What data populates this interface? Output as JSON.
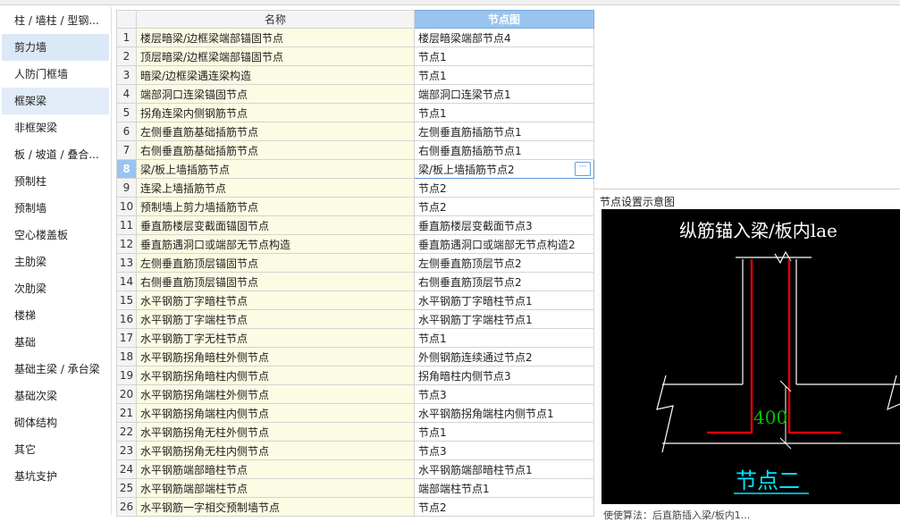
{
  "sidebar": {
    "items": [
      {
        "label": "柱 / 墙柱 / 型钢..."
      },
      {
        "label": "剪力墙"
      },
      {
        "label": "人防门框墙"
      },
      {
        "label": "框架梁"
      },
      {
        "label": "非框架梁"
      },
      {
        "label": "板 / 坡道 / 叠合..."
      },
      {
        "label": "预制柱"
      },
      {
        "label": "预制墙"
      },
      {
        "label": "空心楼盖板"
      },
      {
        "label": "主肋梁"
      },
      {
        "label": "次肋梁"
      },
      {
        "label": "楼梯"
      },
      {
        "label": "基础"
      },
      {
        "label": "基础主梁 / 承台梁"
      },
      {
        "label": "基础次梁"
      },
      {
        "label": "砌体结构"
      },
      {
        "label": "其它"
      },
      {
        "label": "基坑支护"
      }
    ]
  },
  "table": {
    "headers": {
      "index": "",
      "name": "名称",
      "node": "节点图"
    },
    "rows": [
      {
        "idx": "1",
        "name": "楼层暗梁/边框梁端部锚固节点",
        "node": "楼层暗梁端部节点4"
      },
      {
        "idx": "2",
        "name": "顶层暗梁/边框梁端部锚固节点",
        "node": "节点1"
      },
      {
        "idx": "3",
        "name": "暗梁/边框梁遇连梁构造",
        "node": "节点1"
      },
      {
        "idx": "4",
        "name": "端部洞口连梁锚固节点",
        "node": "端部洞口连梁节点1"
      },
      {
        "idx": "5",
        "name": "拐角连梁内侧钢筋节点",
        "node": "节点1"
      },
      {
        "idx": "6",
        "name": "左侧垂直筋基础插筋节点",
        "node": "左侧垂直筋插筋节点1"
      },
      {
        "idx": "7",
        "name": "右侧垂直筋基础插筋节点",
        "node": "右侧垂直筋插筋节点1"
      },
      {
        "idx": "8",
        "name": "梁/板上墙插筋节点",
        "node": "梁/板上墙插筋节点2"
      },
      {
        "idx": "9",
        "name": "连梁上墙插筋节点",
        "node": "节点2"
      },
      {
        "idx": "10",
        "name": "预制墙上剪力墙插筋节点",
        "node": "节点2"
      },
      {
        "idx": "11",
        "name": "垂直筋楼层变截面锚固节点",
        "node": "垂直筋楼层变截面节点3"
      },
      {
        "idx": "12",
        "name": "垂直筋遇洞口或端部无节点构造",
        "node": "垂直筋遇洞口或端部无节点构造2"
      },
      {
        "idx": "13",
        "name": "左侧垂直筋顶层锚固节点",
        "node": "左侧垂直筋顶层节点2"
      },
      {
        "idx": "14",
        "name": "右侧垂直筋顶层锚固节点",
        "node": "右侧垂直筋顶层节点2"
      },
      {
        "idx": "15",
        "name": "水平钢筋丁字暗柱节点",
        "node": "水平钢筋丁字暗柱节点1"
      },
      {
        "idx": "16",
        "name": "水平钢筋丁字端柱节点",
        "node": "水平钢筋丁字端柱节点1"
      },
      {
        "idx": "17",
        "name": "水平钢筋丁字无柱节点",
        "node": "节点1"
      },
      {
        "idx": "18",
        "name": "水平钢筋拐角暗柱外侧节点",
        "node": "外侧钢筋连续通过节点2"
      },
      {
        "idx": "19",
        "name": "水平钢筋拐角暗柱内侧节点",
        "node": "拐角暗柱内侧节点3"
      },
      {
        "idx": "20",
        "name": "水平钢筋拐角端柱外侧节点",
        "node": "节点3"
      },
      {
        "idx": "21",
        "name": "水平钢筋拐角端柱内侧节点",
        "node": "水平钢筋拐角端柱内侧节点1"
      },
      {
        "idx": "22",
        "name": "水平钢筋拐角无柱外侧节点",
        "node": "节点1"
      },
      {
        "idx": "23",
        "name": "水平钢筋拐角无柱内侧节点",
        "node": "节点3"
      },
      {
        "idx": "24",
        "name": "水平钢筋端部暗柱节点",
        "node": "水平钢筋端部暗柱节点1"
      },
      {
        "idx": "25",
        "name": "水平钢筋端部端柱节点",
        "node": "端部端柱节点1"
      },
      {
        "idx": "26",
        "name": "水平钢筋一字相交预制墙节点",
        "node": "节点2"
      }
    ],
    "selected_row": "8",
    "ellipsis_button": "···"
  },
  "preview": {
    "label": "节点设置示意图",
    "diagram_title": "纵筋锚入梁/板内lae",
    "dimension": "400",
    "node_caption": "节点二",
    "colors": {
      "background": "#000000",
      "rebar": "#e00000",
      "outline": "#ffffff",
      "dimension": "#00c000",
      "caption": "#00e5ff"
    }
  },
  "bottom_text": "使使算法：后直筋插入梁/板内1..."
}
